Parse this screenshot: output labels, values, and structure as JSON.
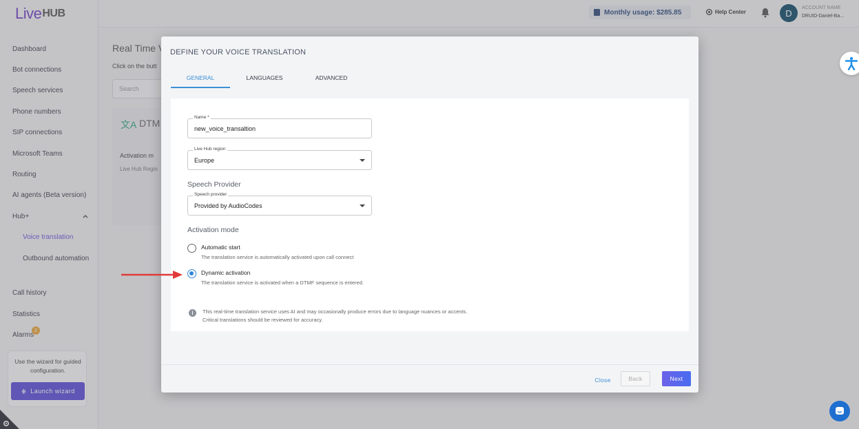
{
  "brand": {
    "live": "Live",
    "hub": "HUB"
  },
  "sidebar": {
    "items": [
      {
        "label": "Dashboard"
      },
      {
        "label": "Bot connections"
      },
      {
        "label": "Speech services"
      },
      {
        "label": "Phone numbers"
      },
      {
        "label": "SIP connections"
      },
      {
        "label": "Microsoft Teams"
      },
      {
        "label": "Routing"
      },
      {
        "label": "AI agents (Beta version)"
      },
      {
        "label": "Hub+"
      },
      {
        "label": "Voice translation"
      },
      {
        "label": "Outbound automation"
      },
      {
        "label": "Call history"
      },
      {
        "label": "Statistics"
      },
      {
        "label": "Alarms"
      }
    ],
    "alarms_badge": "2",
    "wizard_text": "Use the wizard for guided configuration.",
    "wizard_button": "Launch wizard"
  },
  "topbar": {
    "usage": "Monthly usage:  $285.85",
    "help": "Help Center",
    "avatar_initial": "D",
    "account_label": "ACCOUNT NAME",
    "account_name": "DRUID-Daniel-Ba..."
  },
  "background": {
    "title": "Real Time V",
    "subtitle": "Click on the butt",
    "search_placeholder": "Search",
    "card_title": "DTM",
    "card_line1": "Activation m",
    "card_line2": "Live Hub Regio"
  },
  "modal": {
    "title": "DEFINE YOUR VOICE TRANSLATION",
    "tabs": [
      {
        "label": "GENERAL",
        "active": true
      },
      {
        "label": "LANGUAGES",
        "active": false
      },
      {
        "label": "ADVANCED",
        "active": false
      }
    ],
    "name_field": {
      "label": "Name *",
      "value": "new_voice_transaltion"
    },
    "region_field": {
      "label": "Live Hub region",
      "value": "Europe"
    },
    "speech_provider_heading": "Speech Provider",
    "provider_field": {
      "label": "Speech provider",
      "value": "Provided by AudioCodes"
    },
    "activation_heading": "Activation mode",
    "options": [
      {
        "label": "Automatic start",
        "description": "The translation service is automatically activated upon call connect",
        "selected": false
      },
      {
        "label": "Dynamic activation",
        "description": "The translation service is activated when a DTMF sequence is entered.",
        "selected": true
      }
    ],
    "info_line1": "This real-time translation service uses AI and may occasionally produce errors due to language nuances or accents.",
    "info_line2": "Critical translations should be reviewed for accuracy.",
    "buttons": {
      "close": "Close",
      "back": "Back",
      "next": "Next"
    }
  },
  "colors": {
    "accent": "#3b8fd6",
    "brand": "#6f3fc4",
    "arrow": "#e03a3a",
    "next_button": "#5a67ea"
  }
}
